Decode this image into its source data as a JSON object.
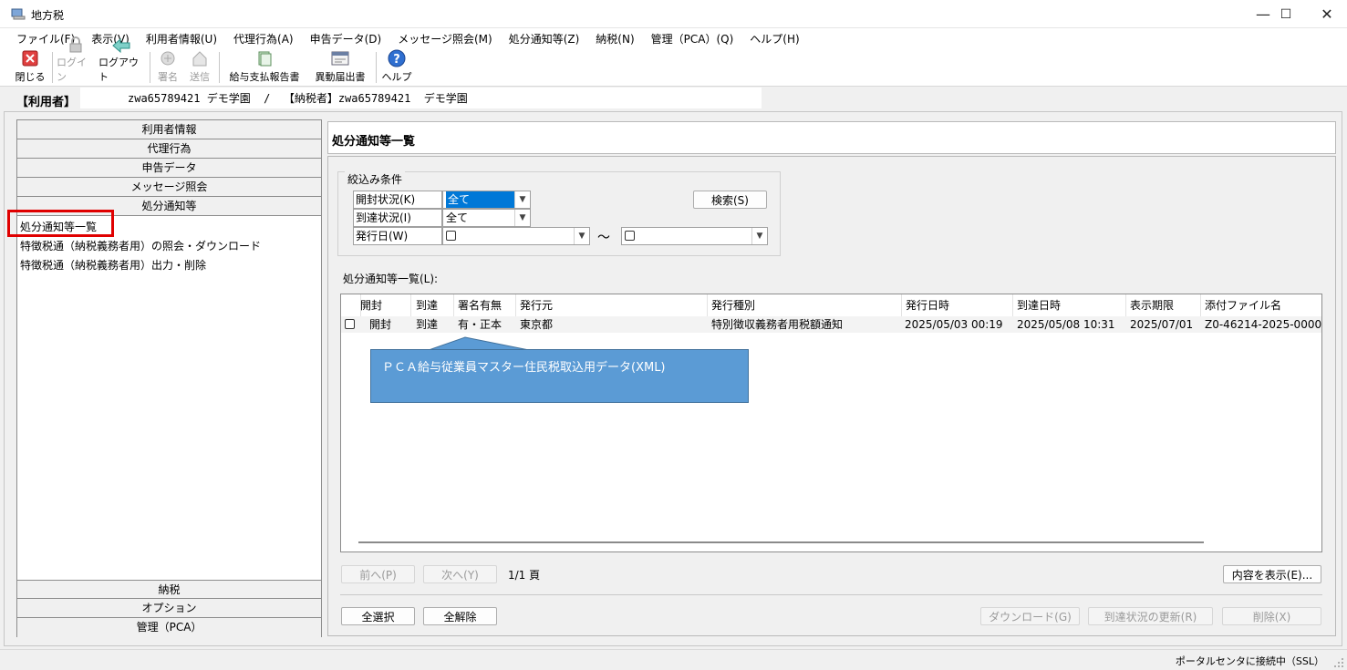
{
  "window": {
    "title": "地方税",
    "controls": [
      "—",
      "☐",
      "✕"
    ]
  },
  "menu": [
    "ファイル(F)",
    "表示(V)",
    "利用者情報(U)",
    "代理行為(A)",
    "申告データ(D)",
    "メッセージ照会(M)",
    "処分通知等(Z)",
    "納税(N)",
    "管理（PCA）(Q)",
    "ヘルプ(H)"
  ],
  "toolbar": {
    "close": "閉じる",
    "login": "ログイン",
    "logout": "ログアウト",
    "sign": "署名",
    "send": "送信",
    "salary_report": "給与支払報告書",
    "change_report": "異動届出書",
    "help": "ヘルプ"
  },
  "userbar": {
    "label": "【利用者】",
    "info": "zwa65789421 デモ学園  /  【納税者】zwa65789421  デモ学園"
  },
  "sidebar": {
    "top_headers": [
      "利用者情報",
      "代理行為",
      "申告データ",
      "メッセージ照会",
      "処分通知等"
    ],
    "items": [
      "処分通知等一覧",
      "特徴税通（納税義務者用）の照会・ダウンロード",
      "特徴税通（納税義務者用）出力・削除"
    ],
    "bottom_headers": [
      "納税",
      "オプション",
      "管理（PCA）"
    ]
  },
  "main": {
    "title": "処分通知等一覧",
    "filter": {
      "group_title": "絞込み条件",
      "open_status_label": "開封状況(K)",
      "open_status_value": "全て",
      "arrival_status_label": "到達状況(I)",
      "arrival_status_value": "全て",
      "issue_date_label": "発行日(W)",
      "tilde": "～",
      "search_button": "検索(S)"
    },
    "list_label": "処分通知等一覧(L):",
    "columns": [
      "開封",
      "到達",
      "署名有無",
      "発行元",
      "発行種別",
      "発行日時",
      "到達日時",
      "表示期限",
      "添付ファイル名"
    ],
    "rows": [
      {
        "open": "開封",
        "arrival": "到達",
        "signature": "有・正本",
        "issuer": "東京都",
        "type": "特別徴収義務者用税額通知",
        "issued": "2025/05/03 00:19",
        "arrived": "2025/05/08 10:31",
        "expiry": "2025/07/01",
        "file": "Z0-46214-2025-0000"
      }
    ],
    "callout": "ＰＣＡ給与従業員マスター住民税取込用データ(XML)",
    "pager": {
      "prev": "前へ(P)",
      "next": "次へ(Y)",
      "page": "1/1 頁",
      "show_content": "内容を表示(E)..."
    },
    "actions": {
      "select_all": "全選択",
      "deselect_all": "全解除",
      "download": "ダウンロード(G)",
      "update_arrival": "到達状況の更新(R)",
      "delete": "削除(X)"
    }
  },
  "status": "ポータルセンタに接続中（SSL）",
  "colors": {
    "accent": "#0078d7",
    "callout": "#5b9bd5",
    "highlight_border": "#e00000"
  }
}
